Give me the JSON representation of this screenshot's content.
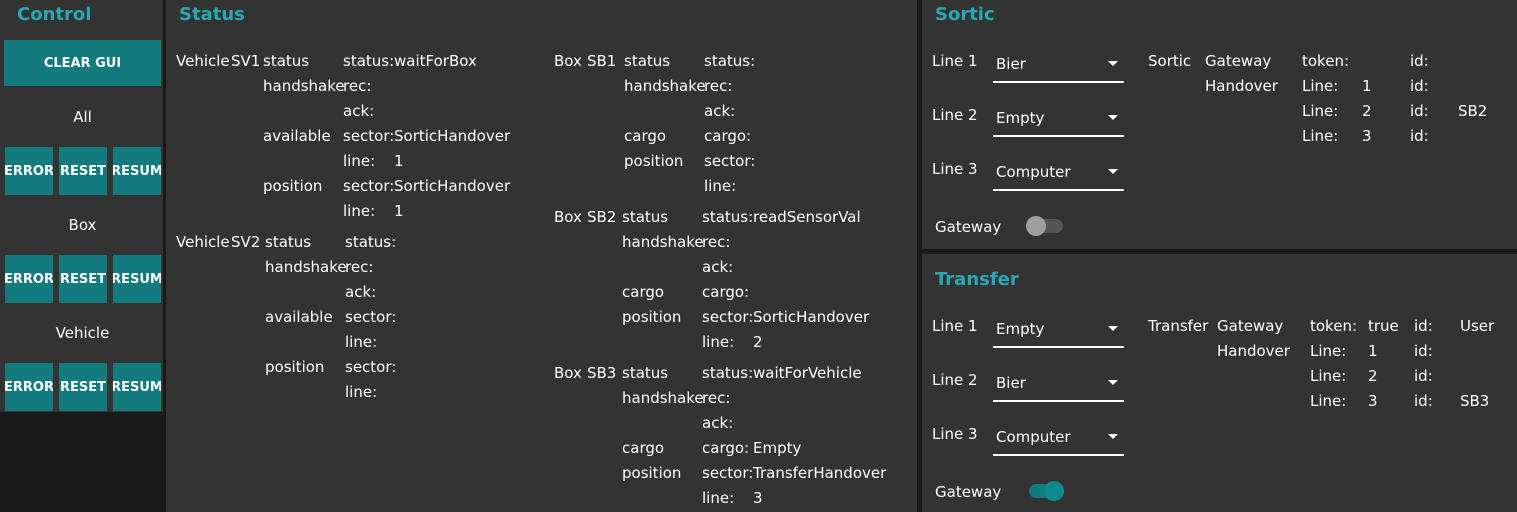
{
  "control": {
    "title": "Control",
    "clear_label": "CLEAR GUI",
    "sections": [
      {
        "label": "All",
        "error": "ERROR",
        "reset": "RESET",
        "resume": "RESUM"
      },
      {
        "label": "Box",
        "error": "ERROR",
        "reset": "RESET",
        "resume": "RESUM"
      },
      {
        "label": "Vehicle",
        "error": "ERROR",
        "reset": "RESET",
        "resume": "RESUM"
      }
    ]
  },
  "status": {
    "title": "Status",
    "vehicles": [
      {
        "type": "Vehicle",
        "id": "SV1",
        "status_label": "status",
        "status_key": "status:",
        "status_value": "waitForBox",
        "handshake_label": "handshake",
        "rec_key": "rec:",
        "rec_value": "",
        "ack_key": "ack:",
        "ack_value": "",
        "available_label": "available",
        "available_sector_key": "sector:",
        "available_sector_value": "SorticHandover",
        "available_line_key": "line:",
        "available_line_value": "1",
        "position_label": "position",
        "position_sector_key": "sector:",
        "position_sector_value": "SorticHandover",
        "position_line_key": "line:",
        "position_line_value": "1"
      },
      {
        "type": "Vehicle",
        "id": "SV2",
        "status_label": "status",
        "status_key": "status:",
        "status_value": "",
        "handshake_label": "handshake",
        "rec_key": "rec:",
        "rec_value": "",
        "ack_key": "ack:",
        "ack_value": "",
        "available_label": "available",
        "available_sector_key": "sector:",
        "available_sector_value": "",
        "available_line_key": "line:",
        "available_line_value": "",
        "position_label": "position",
        "position_sector_key": "sector:",
        "position_sector_value": "",
        "position_line_key": "line:",
        "position_line_value": ""
      }
    ],
    "boxes": [
      {
        "type": "Box",
        "id": "SB1",
        "status_label": "status",
        "status_key": "status:",
        "status_value": "",
        "handshake_label": "handshake",
        "rec_key": "rec:",
        "rec_value": "",
        "ack_key": "ack:",
        "ack_value": "",
        "cargo_label": "cargo",
        "cargo_key": "cargo:",
        "cargo_value": "",
        "position_label": "position",
        "sector_key": "sector:",
        "sector_value": "",
        "line_key": "line:",
        "line_value": ""
      },
      {
        "type": "Box",
        "id": "SB2",
        "status_label": "status",
        "status_key": "status:",
        "status_value": "readSensorVal",
        "handshake_label": "handshake",
        "rec_key": "rec:",
        "rec_value": "",
        "ack_key": "ack:",
        "ack_value": "",
        "cargo_label": "cargo",
        "cargo_key": "cargo:",
        "cargo_value": "",
        "position_label": "position",
        "sector_key": "sector:",
        "sector_value": "SorticHandover",
        "line_key": "line:",
        "line_value": "2"
      },
      {
        "type": "Box",
        "id": "SB3",
        "status_label": "status",
        "status_key": "status:",
        "status_value": "waitForVehicle",
        "handshake_label": "handshake",
        "rec_key": "rec:",
        "rec_value": "",
        "ack_key": "ack:",
        "ack_value": "",
        "cargo_label": "cargo",
        "cargo_key": "cargo:",
        "cargo_value": "Empty",
        "position_label": "position",
        "sector_key": "sector:",
        "sector_value": "TransferHandover",
        "line_key": "line:",
        "line_value": "3"
      }
    ]
  },
  "sortic": {
    "title": "Sortic",
    "lines": [
      {
        "label": "Line 1",
        "value": "Bier"
      },
      {
        "label": "Line 2",
        "value": "Empty"
      },
      {
        "label": "Line 3",
        "value": "Computer"
      }
    ],
    "gateway_label": "Gateway",
    "gateway_on": false,
    "info": {
      "name": "Sortic",
      "gateway": "Gateway",
      "handover": "Handover",
      "token_key": "token:",
      "token_value": "",
      "id_key": "id:",
      "line_key": "Line:",
      "rows": [
        {
          "line": "1",
          "id": ""
        },
        {
          "line": "2",
          "id": "SB2"
        },
        {
          "line": "3",
          "id": ""
        }
      ],
      "token_id": ""
    }
  },
  "transfer": {
    "title": "Transfer",
    "lines": [
      {
        "label": "Line 1",
        "value": "Empty"
      },
      {
        "label": "Line 2",
        "value": "Bier"
      },
      {
        "label": "Line 3",
        "value": "Computer"
      }
    ],
    "gateway_label": "Gateway",
    "gateway_on": true,
    "info": {
      "name": "Transfer",
      "gateway": "Gateway",
      "handover": "Handover",
      "token_key": "token:",
      "token_value": "true",
      "id_key": "id:",
      "line_key": "Line:",
      "rows": [
        {
          "line": "1",
          "id": ""
        },
        {
          "line": "2",
          "id": ""
        },
        {
          "line": "3",
          "id": "SB3"
        }
      ],
      "token_id": "User"
    }
  },
  "colors": {
    "accent": "#26a9b3",
    "button": "#137b7d",
    "panel": "#333333",
    "background": "#1a1a1a",
    "toggle_on_track": "#137b7d",
    "toggle_on_knob": "#0e8a8f",
    "toggle_off_track": "#555555",
    "toggle_off_knob": "#9e9e9e"
  }
}
